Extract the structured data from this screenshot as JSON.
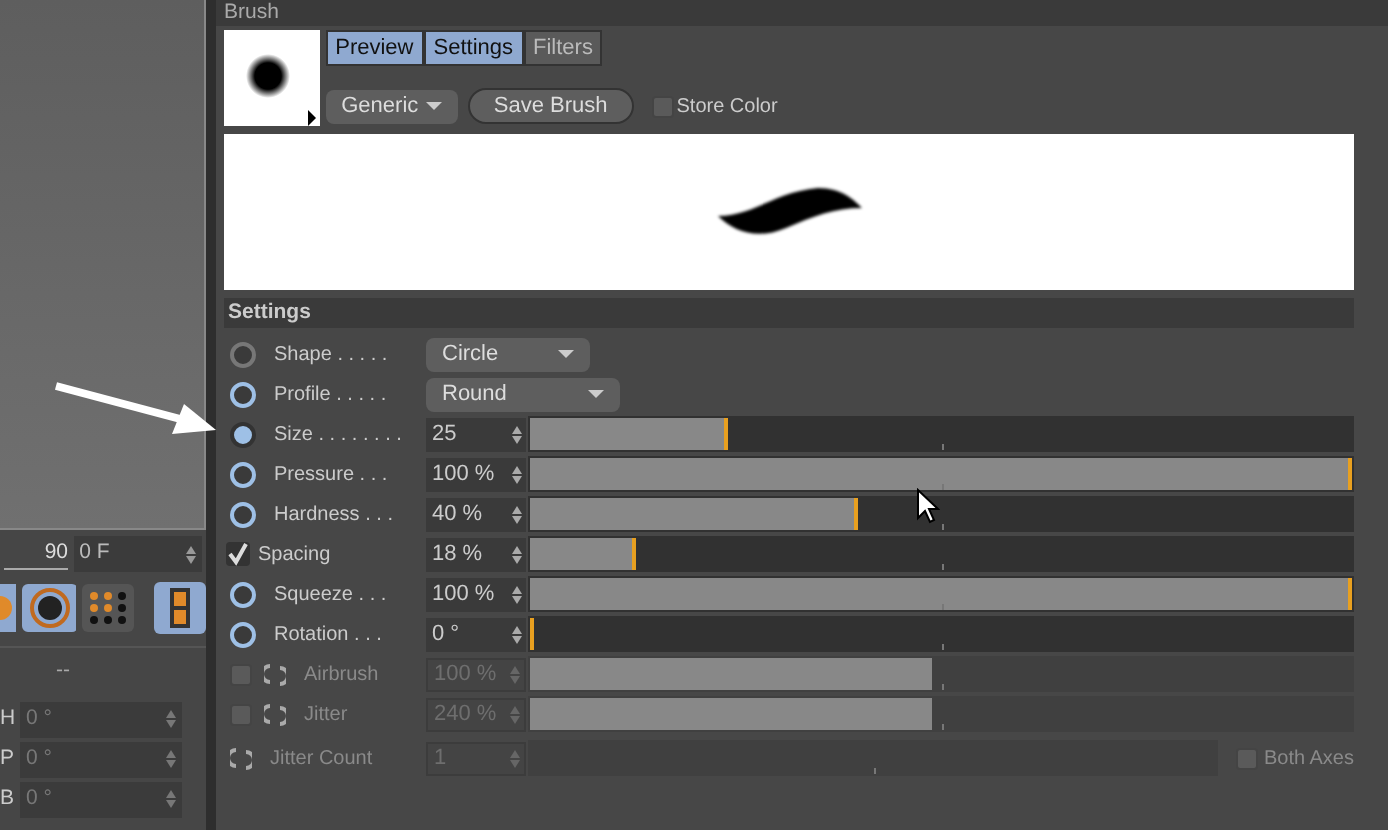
{
  "left_panel": {
    "ruler_value": "90",
    "frame_field": "0 F",
    "section_label": "--",
    "rotation_fields": [
      {
        "axis": "H",
        "value": "0 °"
      },
      {
        "axis": "P",
        "value": "0 °"
      },
      {
        "axis": "B",
        "value": "0 °"
      }
    ]
  },
  "brush": {
    "title": "Brush",
    "tabs": [
      {
        "label": "Preview",
        "selected": true
      },
      {
        "label": "Settings",
        "selected": true
      },
      {
        "label": "Filters",
        "selected": false
      }
    ],
    "preset_dropdown": "Generic",
    "save_button": "Save Brush",
    "store_color": {
      "label": "Store Color",
      "checked": false
    }
  },
  "settings": {
    "title": "Settings",
    "rows": [
      {
        "kind": "dropdown",
        "label": "Shape . . . . .",
        "animatable": false,
        "keyframed": false,
        "value": "Circle"
      },
      {
        "kind": "dropdown",
        "label": "Profile . . . . .",
        "animatable": true,
        "keyframed": false,
        "value": "Round"
      },
      {
        "kind": "slider",
        "label": "Size . . . . . . . .",
        "animatable": true,
        "keyframed": true,
        "value": "25",
        "level": 0.24,
        "disabled": false
      },
      {
        "kind": "slider",
        "label": "Pressure . . .",
        "animatable": true,
        "keyframed": false,
        "value": "100 %",
        "level": 1,
        "disabled": false
      },
      {
        "kind": "slider",
        "label": "Hardness . . .",
        "animatable": true,
        "keyframed": false,
        "value": "40 %",
        "level": 0.4,
        "disabled": false
      },
      {
        "kind": "check",
        "label": "Spacing",
        "checked": true,
        "value": "18 %",
        "level": 0.13,
        "disabled": false
      },
      {
        "kind": "slider",
        "label": "Squeeze . . .",
        "animatable": true,
        "keyframed": false,
        "value": "100 %",
        "level": 1,
        "disabled": false
      },
      {
        "kind": "slider",
        "label": "Rotation . . .",
        "animatable": true,
        "keyframed": false,
        "value": "0 °",
        "level": 0,
        "disabled": false
      },
      {
        "kind": "toggle",
        "label": "Airbrush",
        "checked": false,
        "value": "100 %",
        "level": 0.49,
        "disabled": true
      },
      {
        "kind": "toggle",
        "label": "Jitter",
        "checked": false,
        "value": "240 %",
        "level": 0.49,
        "disabled": true
      },
      {
        "kind": "count",
        "label": "Jitter Count",
        "value": "1",
        "level": 0,
        "disabled": true,
        "option": {
          "label": "Both Axes",
          "checked": false
        }
      }
    ]
  }
}
